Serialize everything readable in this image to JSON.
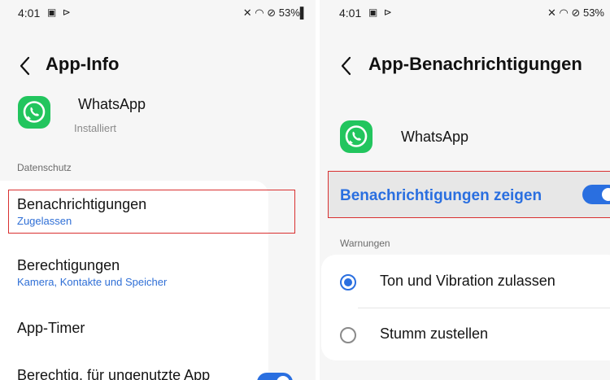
{
  "left_screen": {
    "status": {
      "time": "4:01",
      "icons_left": "▣ ⊳",
      "right": "✕ ◠ ⊘ 53%▌"
    },
    "header": {
      "title": "App-Info"
    },
    "app": {
      "name": "WhatsApp",
      "state": "Installiert"
    },
    "section_label": "Datenschutz",
    "items": [
      {
        "title": "Benachrichtigungen",
        "subtitle": "Zugelassen"
      },
      {
        "title": "Berechtigungen",
        "subtitle": "Kamera, Kontakte und Speicher"
      },
      {
        "title": "App-Timer"
      },
      {
        "title": "Berechtig. für ungenutzte App"
      }
    ]
  },
  "right_screen": {
    "status": {
      "time": "4:01",
      "icons_left": "▣ ⊳",
      "right": "✕ ◠ ⊘ 53%"
    },
    "header": {
      "title": "App-Benachrichtigungen"
    },
    "app": {
      "name": "WhatsApp"
    },
    "show_notifications_label": "Benachrichtigungen zeigen",
    "section_label": "Warnungen",
    "options": [
      {
        "label": "Ton und Vibration zulassen",
        "selected": true
      },
      {
        "label": "Stumm zustellen",
        "selected": false
      }
    ]
  },
  "colors": {
    "accent": "#2a6fe0",
    "highlight": "#d93030",
    "whatsapp": "#22c55e"
  }
}
